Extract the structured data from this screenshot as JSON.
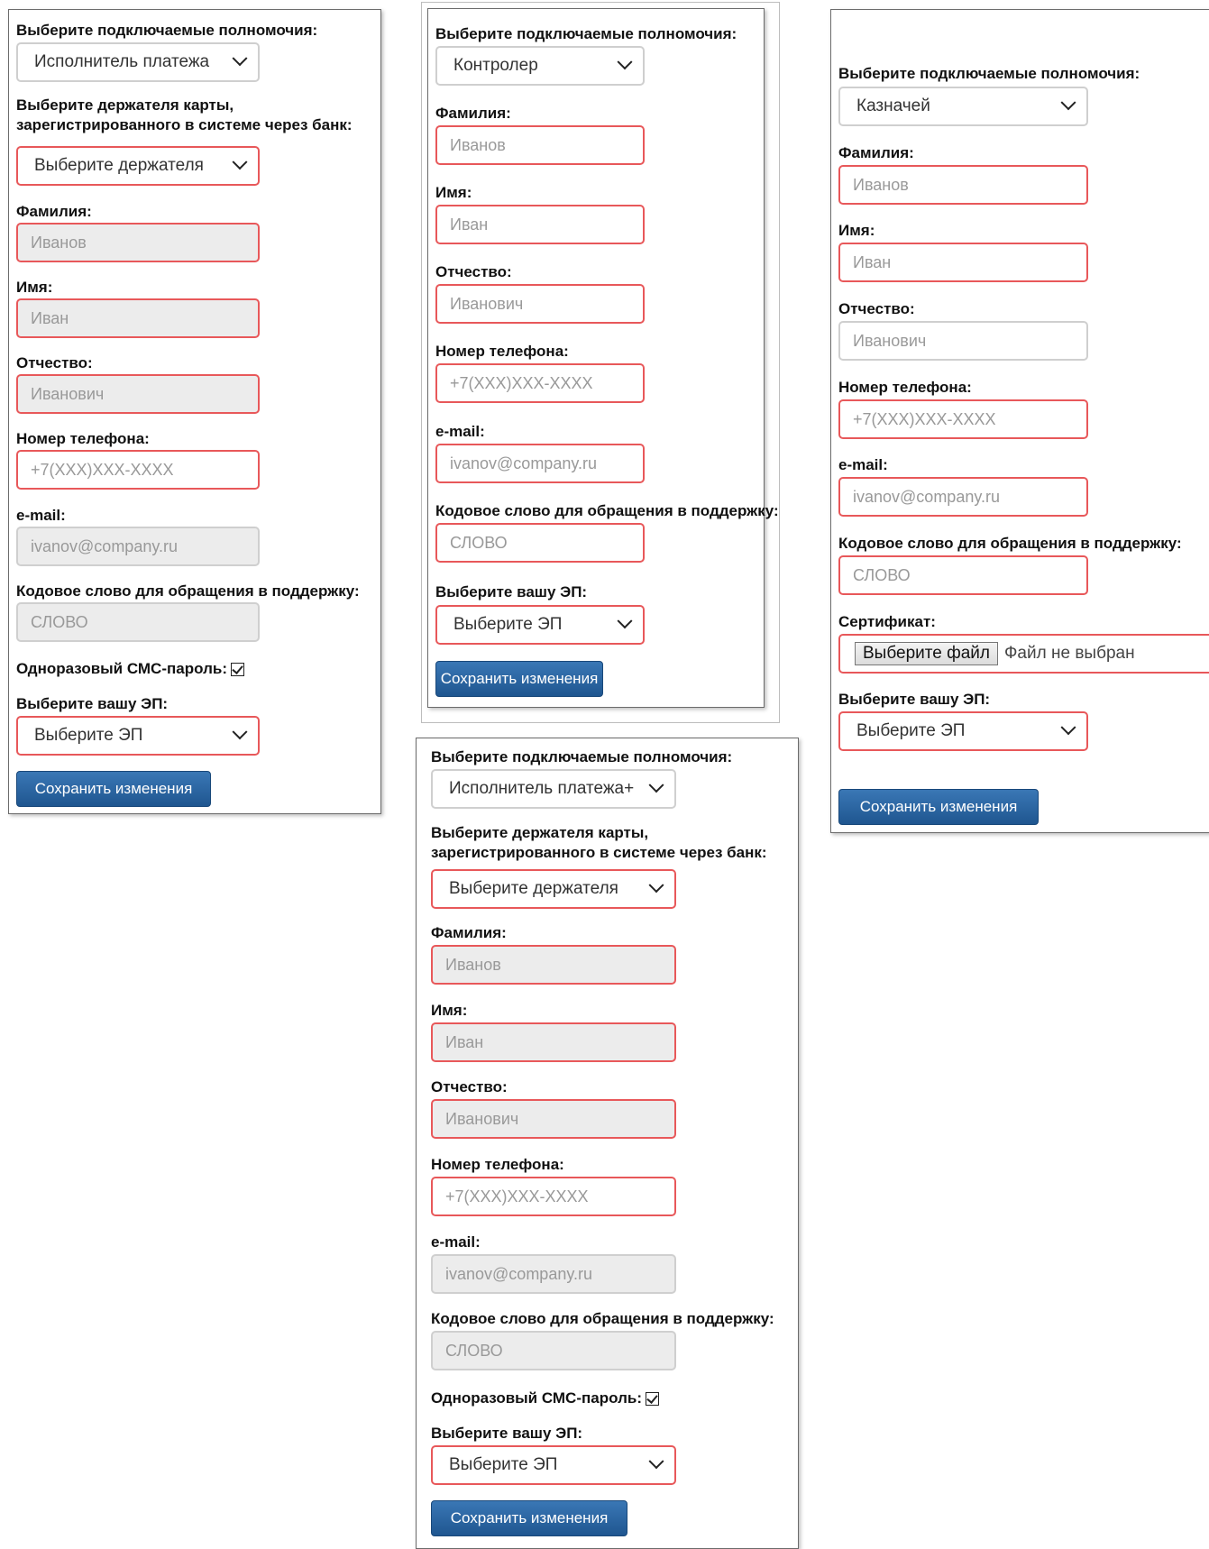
{
  "panel1": {
    "authority_label": "Выберите подключаемые полномочия:",
    "authority_value": "Исполнитель платежа",
    "holder_label_line1": "Выберите держателя карты,",
    "holder_label_line2": "зарегистрированного в системе через банк:",
    "holder_value": "Выберите держателя",
    "surname_label": "Фамилия:",
    "surname_value": "Иванов",
    "name_label": "Имя:",
    "name_value": "Иван",
    "patronymic_label": "Отчество:",
    "patronymic_value": "Иванович",
    "phone_label": "Номер телефона:",
    "phone_placeholder": "+7(XXX)XXX-XXXX",
    "email_label": "e-mail:",
    "email_value": "ivanov@company.ru",
    "codeword_label": "Кодовое слово для обращения в поддержку:",
    "codeword_value": "СЛОВО",
    "sms_label": "Одноразовый СМС-пароль:",
    "sms_checked": true,
    "ep_label": "Выберите вашу ЭП:",
    "ep_value": "Выберите ЭП",
    "save_button": "Сохранить изменения"
  },
  "panel2": {
    "authority_label": "Выберите подключаемые полномочия:",
    "authority_value": "Контролер",
    "surname_label": "Фамилия:",
    "surname_value": "Иванов",
    "name_label": "Имя:",
    "name_value": "Иван",
    "patronymic_label": "Отчество:",
    "patronymic_value": "Иванович",
    "phone_label": "Номер телефона:",
    "phone_placeholder": "+7(XXX)XXX-XXXX",
    "email_label": "e-mail:",
    "email_value": "ivanov@company.ru",
    "codeword_label": "Кодовое слово для обращения в поддержку:",
    "codeword_value": "СЛОВО",
    "ep_label": "Выберите вашу ЭП:",
    "ep_value": "Выберите ЭП",
    "save_button": "Сохранить изменения"
  },
  "panel3": {
    "authority_label": "Выберите подключаемые полномочия:",
    "authority_value": "Казначей",
    "surname_label": "Фамилия:",
    "surname_value": "Иванов",
    "name_label": "Имя:",
    "name_value": "Иван",
    "patronymic_label": "Отчество:",
    "patronymic_value": "Иванович",
    "phone_label": "Номер телефона:",
    "phone_placeholder": "+7(XXX)XXX-XXXX",
    "email_label": "e-mail:",
    "email_value": "ivanov@company.ru",
    "codeword_label": "Кодовое слово для обращения в поддержку:",
    "codeword_value": "СЛОВО",
    "certificate_label": "Сертификат:",
    "file_button": "Выберите файл",
    "file_status": "Файл не выбран",
    "ep_label": "Выберите вашу ЭП:",
    "ep_value": "Выберите ЭП",
    "save_button": "Сохранить изменения"
  },
  "panel4": {
    "authority_label": "Выберите подключаемые полномочия:",
    "authority_value": "Исполнитель платежа+",
    "holder_label_line1": "Выберите держателя карты,",
    "holder_label_line2": "зарегистрированного в системе через банк:",
    "holder_value": "Выберите держателя",
    "surname_label": "Фамилия:",
    "surname_value": "Иванов",
    "name_label": "Имя:",
    "name_value": "Иван",
    "patronymic_label": "Отчество:",
    "patronymic_value": "Иванович",
    "phone_label": "Номер телефона:",
    "phone_placeholder": "+7(XXX)XXX-XXXX",
    "email_label": "e-mail:",
    "email_value": "ivanov@company.ru",
    "codeword_label": "Кодовое слово для обращения в поддержку:",
    "codeword_value": "СЛОВО",
    "sms_label": "Одноразовый СМС-пароль:",
    "sms_checked": true,
    "ep_label": "Выберите вашу ЭП:",
    "ep_value": "Выберите ЭП",
    "save_button": "Сохранить изменения"
  },
  "colors": {
    "error_border": "#e8585a",
    "button_blue": "#1f5690",
    "readonly_bg": "#ececec"
  }
}
